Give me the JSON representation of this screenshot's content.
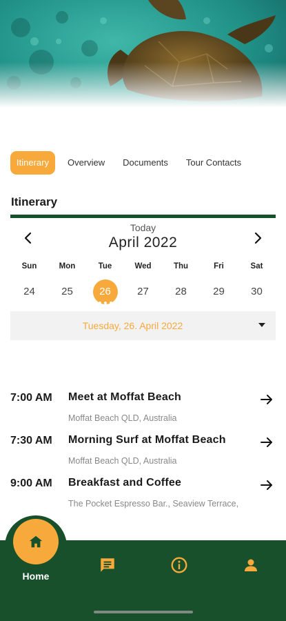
{
  "hero": {
    "image": "sea-turtle-underwater-photo"
  },
  "tabs": [
    {
      "label": "Itinerary",
      "active": true
    },
    {
      "label": "Overview",
      "active": false
    },
    {
      "label": "Documents",
      "active": false
    },
    {
      "label": "Tour Contacts",
      "active": false
    }
  ],
  "section_title": "Itinerary",
  "calendar": {
    "today_label": "Today",
    "month_label": "April 2022",
    "weekdays": [
      "Sun",
      "Mon",
      "Tue",
      "Wed",
      "Thu",
      "Fri",
      "Sat"
    ],
    "dates": [
      "24",
      "25",
      "26",
      "27",
      "28",
      "29",
      "30"
    ],
    "selected_date": "26",
    "dates_with_events": [
      "26",
      "27"
    ],
    "selected_label": "Tuesday, 26. April 2022"
  },
  "events": [
    {
      "time": "7:00 AM",
      "title": "Meet at Moffat Beach",
      "location": "Moffat Beach QLD, Australia"
    },
    {
      "time": "7:30 AM",
      "title": "Morning Surf at Moffat Beach",
      "location": "Moffat Beach QLD, Australia"
    },
    {
      "time": "9:00 AM",
      "title": "Breakfast and Coffee",
      "location": "The Pocket Espresso Bar., Seaview Terrace, Moffat Beach QLD, Australia"
    }
  ],
  "nav": {
    "home_label": "Home",
    "icons": [
      "home-icon",
      "chat-icon",
      "info-icon",
      "profile-icon"
    ]
  },
  "colors": {
    "accent": "#f7a93b",
    "brand_green": "#17502a",
    "date_bar_bg": "#f2f2f2"
  }
}
